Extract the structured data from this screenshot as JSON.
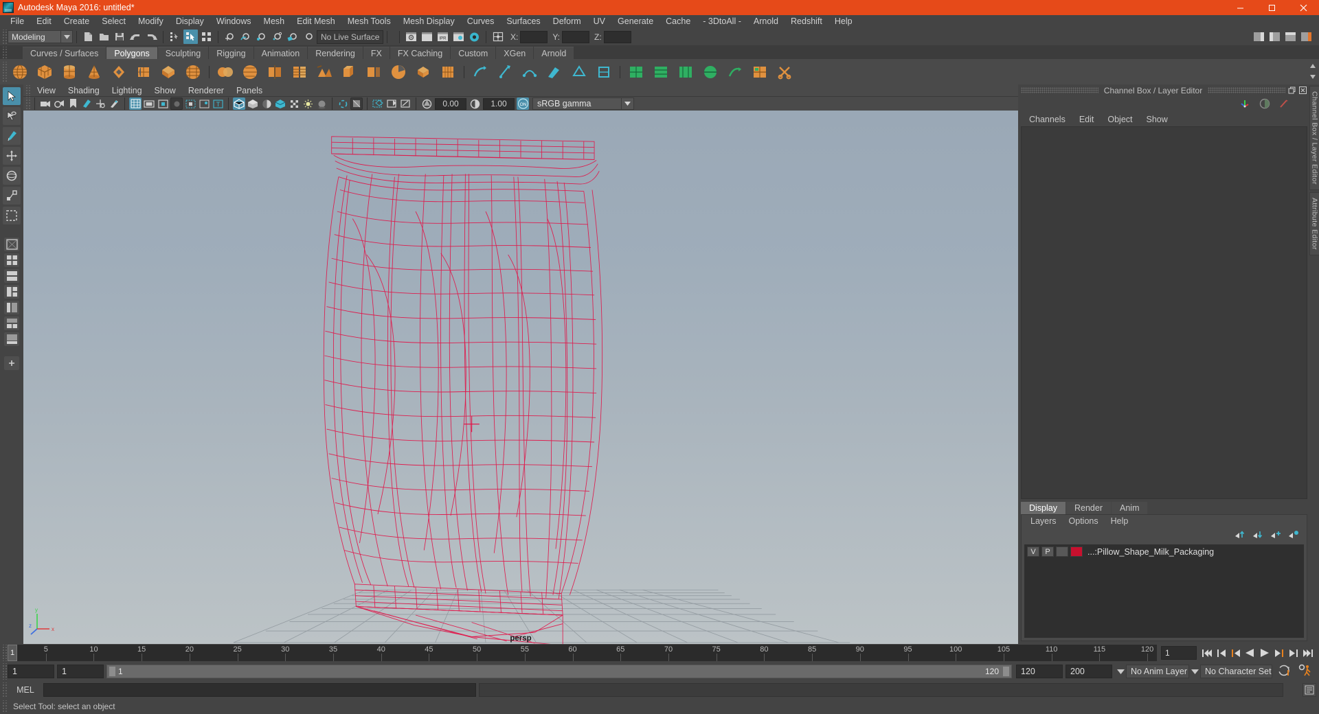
{
  "window": {
    "title": "Autodesk Maya 2016: untitled*",
    "logo_icon": "maya-logo-icon",
    "minimize_icon": "minimize-icon",
    "maximize_icon": "maximize-icon",
    "close_icon": "close-icon",
    "titlebar_color": "#e64a19"
  },
  "menubar": {
    "items": [
      "File",
      "Edit",
      "Create",
      "Select",
      "Modify",
      "Display",
      "Windows",
      "Mesh",
      "Edit Mesh",
      "Mesh Tools",
      "Mesh Display",
      "Curves",
      "Surfaces",
      "Deform",
      "UV",
      "Generate",
      "Cache",
      "- 3DtoAll -",
      "Arnold",
      "Redshift",
      "Help"
    ]
  },
  "statusline": {
    "mode": "Modeling",
    "mode_arrow_icon": "chevron-down-icon",
    "new_scene_icon": "new-scene-icon",
    "open_scene_icon": "open-scene-icon",
    "save_scene_icon": "save-scene-icon",
    "undo_icon": "undo-icon",
    "redo_icon": "redo-icon",
    "select_hierarchy_icon": "select-by-hierarchy-icon",
    "select_object_icon": "select-by-object-type-icon",
    "select_component_icon": "select-by-component-type-icon",
    "snap_grid_icon": "snap-to-grid-icon",
    "snap_curve_icon": "snap-to-curve-icon",
    "snap_point_icon": "snap-to-point-icon",
    "snap_projected_icon": "snap-to-projected-center-icon",
    "snap_view_plane_icon": "snap-to-view-plane-icon",
    "make_live_icon": "make-live-icon",
    "live_surface_label": "No Live Surface",
    "render_current_icon": "render-current-frame-icon",
    "ipr_render_icon": "ipr-render-icon",
    "render_settings_icon": "render-settings-icon",
    "render_view_icon": "render-view-icon",
    "hypershade_icon": "hypershade-icon",
    "construction_history_icon": "construction-history-icon",
    "field_x_label": "X:",
    "field_y_label": "Y:",
    "field_z_label": "Z:",
    "field_x_value": "",
    "field_y_value": "",
    "field_z_value": "",
    "sidebar_toggles": [
      "show-hide-modeling-toolkit-icon",
      "show-hide-attribute-editor-icon",
      "show-hide-tool-settings-icon",
      "show-hide-channel-box-icon"
    ]
  },
  "shelf": {
    "tabs": [
      {
        "label": "Curves / Surfaces",
        "active": false
      },
      {
        "label": "Polygons",
        "active": true
      },
      {
        "label": "Sculpting",
        "active": false
      },
      {
        "label": "Rigging",
        "active": false
      },
      {
        "label": "Animation",
        "active": false
      },
      {
        "label": "Rendering",
        "active": false
      },
      {
        "label": "FX",
        "active": false
      },
      {
        "label": "FX Caching",
        "active": false
      },
      {
        "label": "Custom",
        "active": false
      },
      {
        "label": "XGen",
        "active": false
      },
      {
        "label": "Arnold",
        "active": false
      }
    ],
    "icons": [
      "poly-sphere-icon",
      "poly-cube-icon",
      "poly-cylinder-icon",
      "poly-cone-icon",
      "poly-torus-icon",
      "poly-plane-icon",
      "poly-disc-icon",
      "poly-platonic-icon",
      "poly-combine-icon",
      "poly-smooth-icon",
      "poly-mirror-icon",
      "poly-bevel-icon",
      "poly-bridge-icon",
      "poly-extrude-icon",
      "poly-append-icon",
      "poly-wedge-icon",
      "poly-boolean-icon",
      "poly-reduce-icon",
      "poly-triangulate-icon",
      "poly-quadrangulate-icon",
      "poly-crease-icon",
      "poly-multicut-icon",
      "poly-target-weld-icon",
      "poly-sculpt-icon",
      "uv-planar-icon",
      "uv-cylindrical-icon",
      "uv-spherical-icon",
      "uv-automatic-icon",
      "uv-camera-icon",
      "uv-editor-icon",
      "uv-unfold-icon"
    ],
    "scroll_up_icon": "scroll-up-icon",
    "scroll_down_icon": "scroll-down-icon"
  },
  "toolbox": {
    "tools": [
      {
        "name": "select-tool",
        "icon": "arrow-cursor-icon",
        "selected": true
      },
      {
        "name": "lasso-tool",
        "icon": "lasso-icon",
        "selected": false
      },
      {
        "name": "paint-select-tool",
        "icon": "paint-brush-icon",
        "selected": false
      },
      {
        "name": "move-tool",
        "icon": "move-arrows-icon",
        "selected": false
      },
      {
        "name": "rotate-tool",
        "icon": "rotate-circle-icon",
        "selected": false
      },
      {
        "name": "scale-tool",
        "icon": "scale-box-icon",
        "selected": false
      },
      {
        "name": "last-tool",
        "icon": "last-used-tool-icon",
        "selected": false
      }
    ],
    "layouts": [
      {
        "name": "single-perspective-layout",
        "icon": "single-pane-icon"
      },
      {
        "name": "four-view-layout",
        "icon": "four-pane-icon"
      },
      {
        "name": "two-pane-stacked-layout",
        "icon": "two-pane-stacked-icon"
      },
      {
        "name": "three-pane-layout",
        "icon": "three-pane-icon"
      },
      {
        "name": "outliner-persp-layout",
        "icon": "outliner-persp-icon"
      },
      {
        "name": "hypergraph-layout",
        "icon": "hypergraph-icon"
      },
      {
        "name": "persp-graph-layout",
        "icon": "persp-graph-icon"
      },
      {
        "name": "quick-layout-more",
        "icon": "plus-icon"
      }
    ]
  },
  "panel": {
    "menus": [
      "View",
      "Shading",
      "Lighting",
      "Show",
      "Renderer",
      "Panels"
    ],
    "toolbar": {
      "select_camera_icon": "select-camera-icon",
      "lock_camera_icon": "lock-camera-icon",
      "camera_attributes_icon": "camera-attributes-icon",
      "bookmark_icon": "bookmark-icon",
      "image_plane_icon": "image-plane-icon",
      "two_d_pan_zoom_icon": "2d-pan-zoom-icon",
      "grease_pencil_icon": "grease-pencil-icon",
      "grid_icon": "grid-toggle-icon",
      "film_gate_icon": "film-gate-icon",
      "resolution_gate_icon": "resolution-gate-icon",
      "gate_mask_icon": "gate-mask-icon",
      "field_chart_icon": "field-chart-icon",
      "safe_action_icon": "safe-action-icon",
      "safe_title_icon": "safe-title-icon",
      "wireframe_icon": "wireframe-shading-icon",
      "smooth_shade_icon": "smooth-shade-all-icon",
      "shade_wire_icon": "shaded-wireframe-icon",
      "textured_icon": "hardware-texturing-icon",
      "use_default_light_icon": "use-default-lighting-icon",
      "shadows_icon": "shadows-icon",
      "ao_icon": "ambient-occlusion-icon",
      "motion_blur_icon": "motion-blur-icon",
      "aa_icon": "anti-aliasing-icon",
      "multisample_icon": "multisample-icon",
      "xray_icon": "xray-mode-icon",
      "xray_joints_icon": "xray-joints-icon",
      "xray_active_icon": "xray-active-components-icon",
      "exposure_icon": "exposure-icon",
      "exposure_value": "0.00",
      "gamma_icon": "gamma-icon",
      "gamma_value": "1.00",
      "color_management_icon": "color-management-on-icon",
      "color_profile": "sRGB gamma",
      "color_profile_arrow_icon": "chevron-down-icon"
    },
    "camera_label": "persp",
    "axis_gizmo_icon": "axis-gizmo-icon",
    "axis_labels": {
      "x": "x",
      "y": "y",
      "z": "z"
    }
  },
  "channelbox": {
    "panel_title": "Channel Box / Layer Editor",
    "restore_icon": "restore-panel-icon",
    "close_icon": "close-panel-icon",
    "header_icons": [
      "channel-box-icon",
      "attribute-editor-icon",
      "tool-settings-icon"
    ],
    "menus": [
      "Channels",
      "Edit",
      "Object",
      "Show"
    ],
    "content": ""
  },
  "layereditor": {
    "tabs": [
      {
        "label": "Display",
        "active": true
      },
      {
        "label": "Render",
        "active": false
      },
      {
        "label": "Anim",
        "active": false
      }
    ],
    "menus": [
      "Layers",
      "Options",
      "Help"
    ],
    "tool_icons": [
      "move-layer-up-icon",
      "move-layer-down-icon",
      "new-layer-icon",
      "new-layer-from-selected-icon"
    ],
    "layers": [
      {
        "visibility": "V",
        "playback": "P",
        "shading": "",
        "color": "#c8102e",
        "name": "...:Pillow_Shape_Milk_Packaging"
      }
    ]
  },
  "edge_tabs": [
    "Channel Box / Layer Editor",
    "Attribute Editor"
  ],
  "timeslider": {
    "current_frame_marker": "1",
    "current_frame_field": "1",
    "ticks": [
      5,
      10,
      15,
      20,
      25,
      30,
      35,
      40,
      45,
      50,
      55,
      60,
      65,
      70,
      75,
      80,
      85,
      90,
      95,
      100,
      105,
      110,
      115,
      120
    ],
    "playback_buttons": [
      "go-to-start-icon",
      "step-back-frame-icon",
      "step-back-key-icon",
      "play-backwards-icon",
      "play-forwards-icon",
      "step-forward-key-icon",
      "step-forward-frame-icon",
      "go-to-end-icon"
    ]
  },
  "rangeslider": {
    "start_field": "1",
    "end_field": "1",
    "range_start": "1",
    "range_end": "120",
    "playback_start_field": "120",
    "playback_end_field": "200",
    "anim_layer": "No Anim Layer",
    "character_set": "No Character Set",
    "anim_layer_arrow_icon": "chevron-down-icon",
    "character_set_arrow_icon": "chevron-down-icon",
    "auto_key_icon": "auto-keyframe-toggle-icon",
    "animation_preferences_icon": "animation-preferences-icon"
  },
  "commandline": {
    "language_label": "MEL",
    "input_value": "",
    "output_value": "",
    "script_editor_icon": "script-editor-icon"
  },
  "helpline": {
    "text": "Select Tool: select an object"
  },
  "model": {
    "wireframe_color": "#e0174a",
    "name": "Pillow_Shape_Milk_Packaging",
    "grid_color": "#8d959b",
    "background_top": "#9aa8b6",
    "background_bottom": "#bcc3c6"
  }
}
